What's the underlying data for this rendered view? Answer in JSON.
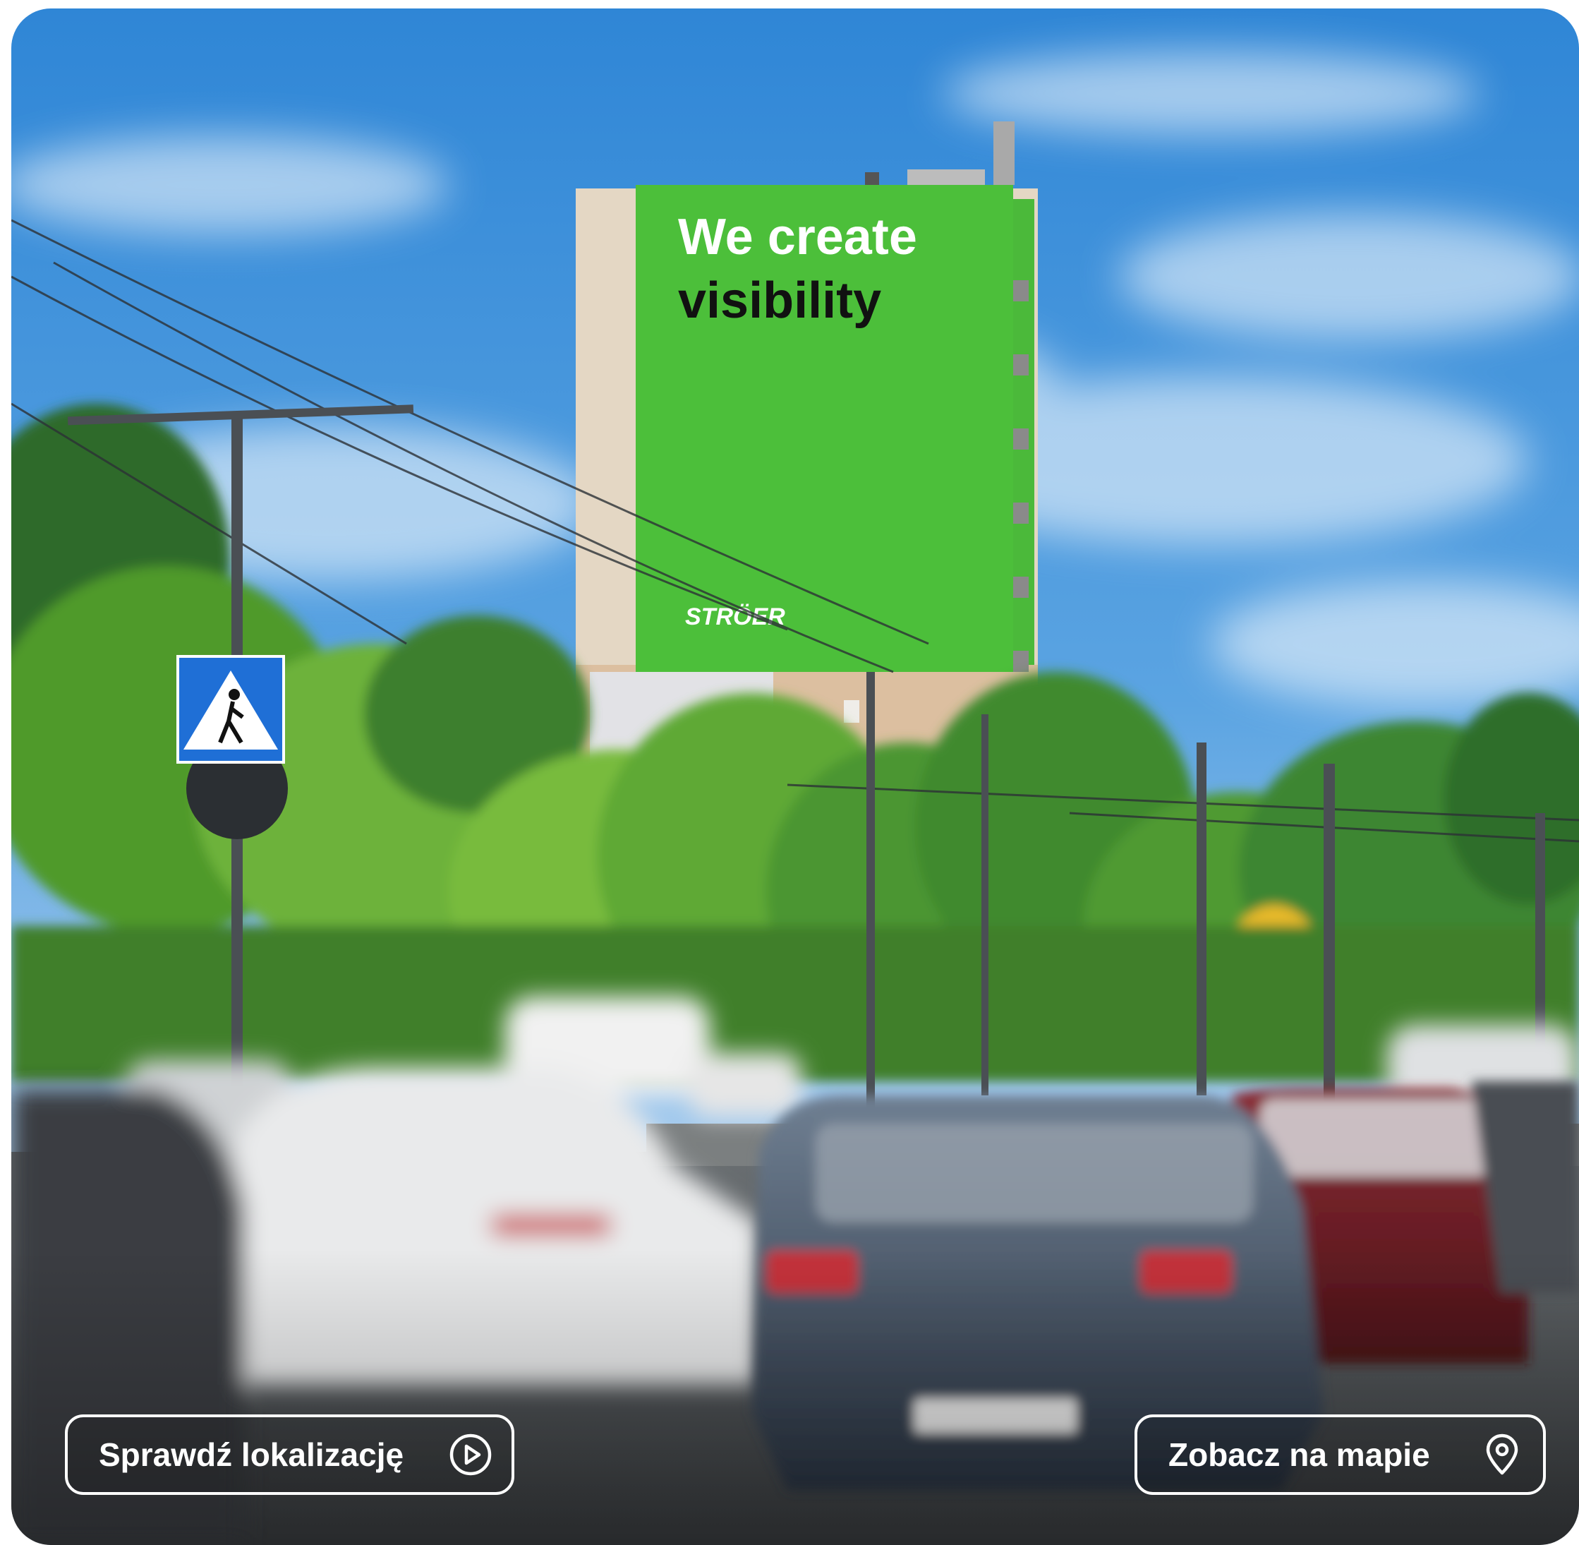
{
  "billboard": {
    "headline_line1": "We create",
    "headline_line2": "visibility",
    "brand": "STRÖER"
  },
  "actions": {
    "check_location_label": "Sprawdź lokalizację",
    "check_location_icon": "play-circle-icon",
    "map_label": "Zobacz na mapie",
    "map_icon": "map-pin-icon"
  },
  "colors": {
    "billboard_green": "#4cbf3a",
    "sky_blue": "#3d8fd8",
    "button_border": "#ffffff"
  }
}
